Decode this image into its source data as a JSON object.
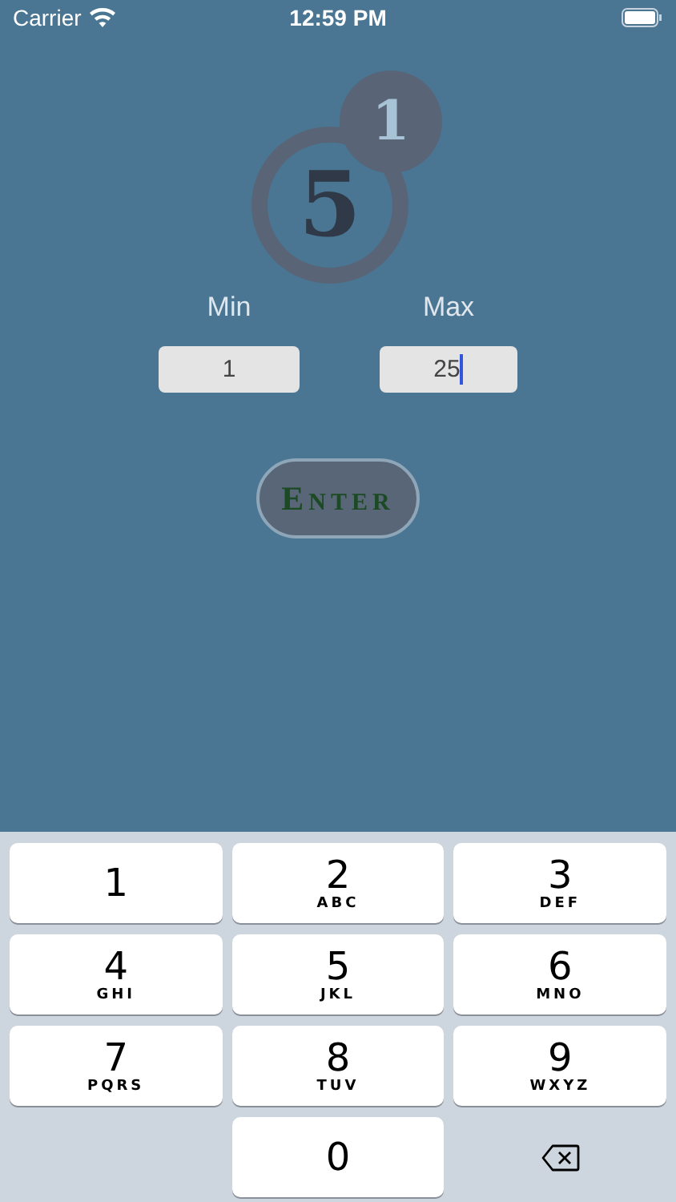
{
  "status_bar": {
    "carrier": "Carrier",
    "time": "12:59 PM"
  },
  "logo": {
    "main": "5",
    "superscript": "1"
  },
  "fields": [
    {
      "label": "Min",
      "value": "1",
      "focused": false
    },
    {
      "label": "Max",
      "value": "25",
      "focused": true
    }
  ],
  "enter_button": {
    "label": "Enter"
  },
  "keypad": [
    {
      "kind": "digit",
      "digit": "1"
    },
    {
      "kind": "digit",
      "digit": "2",
      "letters": "ABC"
    },
    {
      "kind": "digit",
      "digit": "3",
      "letters": "DEF"
    },
    {
      "kind": "digit",
      "digit": "4",
      "letters": "GHI"
    },
    {
      "kind": "digit",
      "digit": "5",
      "letters": "JKL"
    },
    {
      "kind": "digit",
      "digit": "6",
      "letters": "MNO"
    },
    {
      "kind": "digit",
      "digit": "7",
      "letters": "PQRS"
    },
    {
      "kind": "digit",
      "digit": "8",
      "letters": "TUV"
    },
    {
      "kind": "digit",
      "digit": "9",
      "letters": "WXYZ"
    },
    {
      "kind": "blank"
    },
    {
      "kind": "digit",
      "digit": "0"
    },
    {
      "kind": "delete"
    }
  ]
}
